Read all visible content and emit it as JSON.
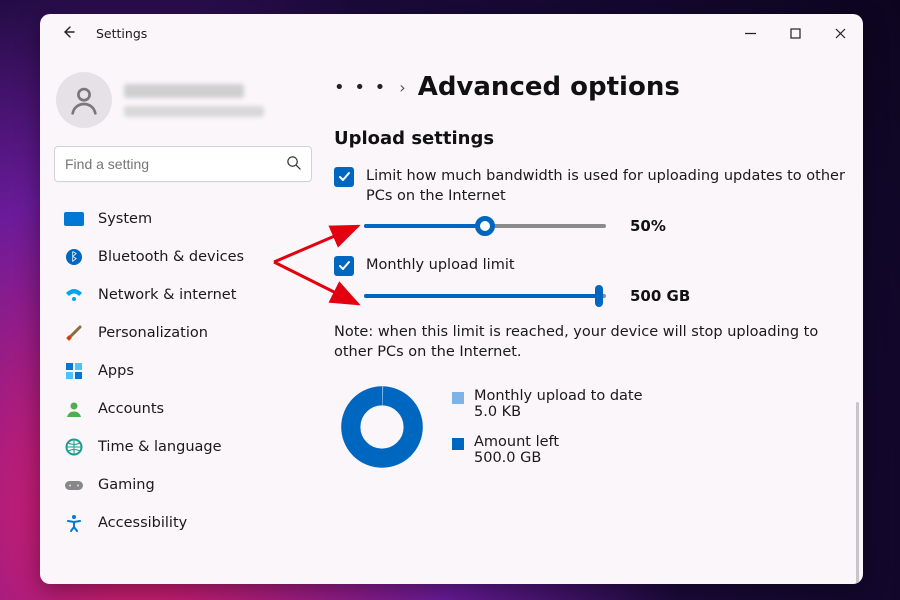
{
  "window": {
    "app_title": "Settings",
    "back_icon": "←"
  },
  "search": {
    "placeholder": "Find a setting"
  },
  "sidebar": {
    "items": [
      {
        "label": "System"
      },
      {
        "label": "Bluetooth & devices"
      },
      {
        "label": "Network & internet"
      },
      {
        "label": "Personalization"
      },
      {
        "label": "Apps"
      },
      {
        "label": "Accounts"
      },
      {
        "label": "Time & language"
      },
      {
        "label": "Gaming"
      },
      {
        "label": "Accessibility"
      }
    ]
  },
  "breadcrumb": {
    "dots": "• • •",
    "chevron": "›",
    "title": "Advanced options"
  },
  "upload": {
    "section_title": "Upload settings",
    "bandwidth_label": "Limit how much bandwidth is used for uploading updates to other PCs on the Internet",
    "bandwidth_checked": true,
    "bandwidth_pct": 50,
    "bandwidth_pct_label": "50%",
    "monthly_label": "Monthly upload limit",
    "monthly_checked": true,
    "monthly_pct": 97,
    "monthly_value_label": "500 GB",
    "note": "Note: when this limit is reached, your device will stop uploading to other PCs on the Internet.",
    "stats": {
      "to_date_label": "Monthly upload to date",
      "to_date_value": "5.0 KB",
      "left_label": "Amount left",
      "left_value": "500.0 GB"
    }
  },
  "colors": {
    "accent": "#0067c0",
    "accent_light": "#7db4e6"
  }
}
